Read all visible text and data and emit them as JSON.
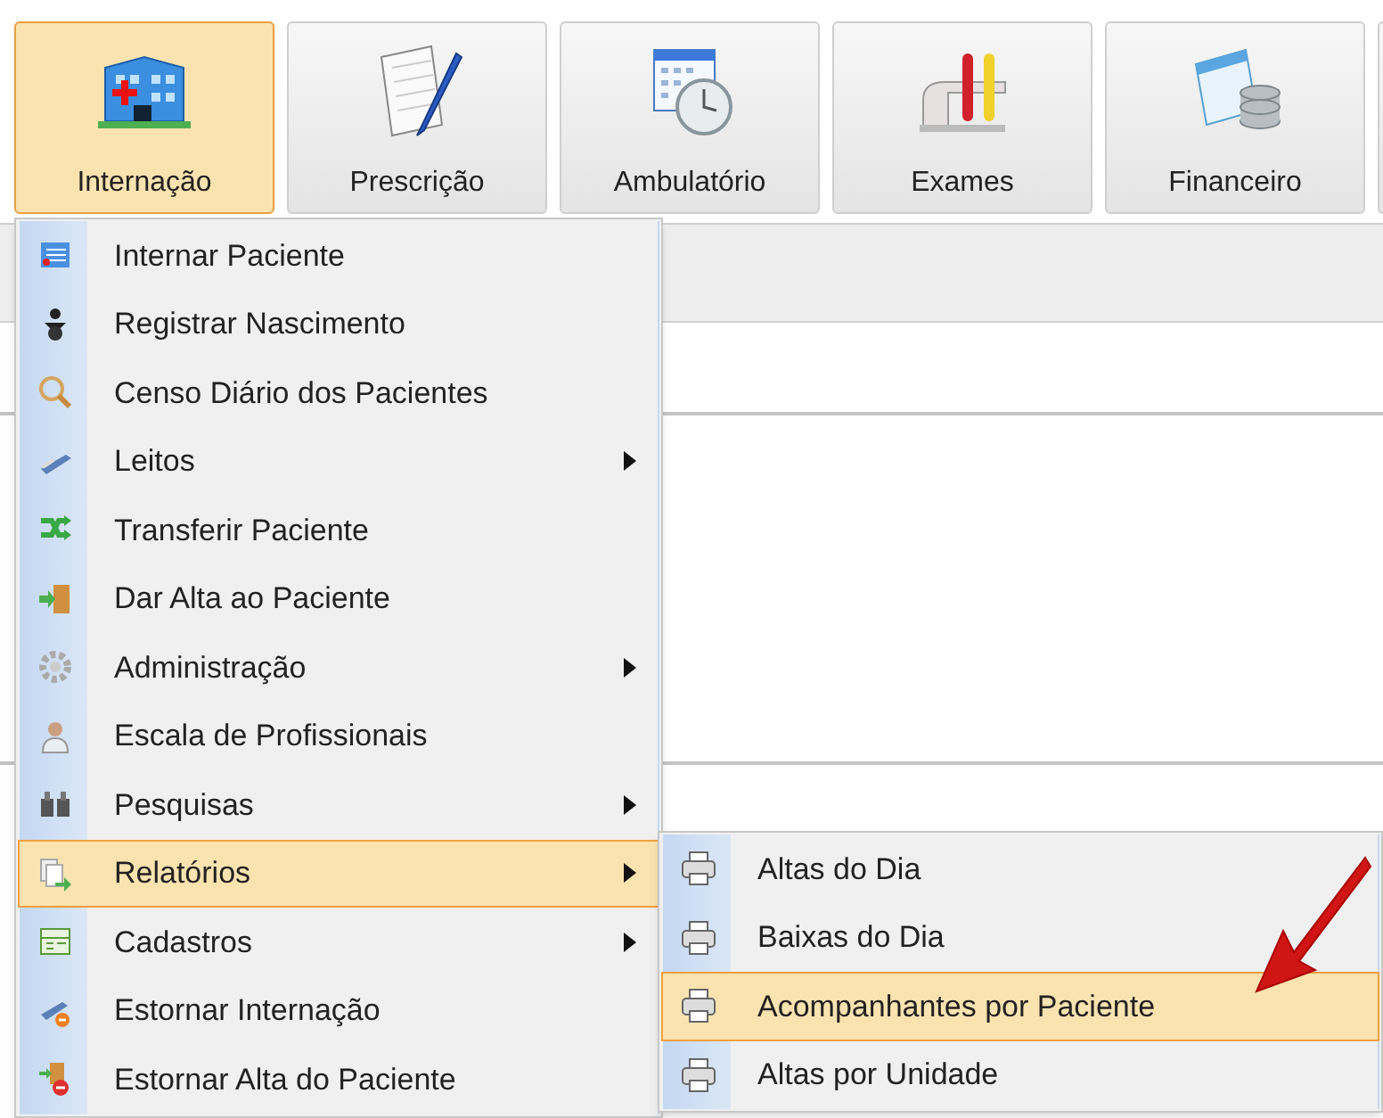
{
  "toolbar": [
    {
      "label": "Internação",
      "selected": true
    },
    {
      "label": "Prescrição",
      "selected": false
    },
    {
      "label": "Ambulatório",
      "selected": false
    },
    {
      "label": "Exames",
      "selected": false
    },
    {
      "label": "Financeiro",
      "selected": false
    }
  ],
  "menu": {
    "items": [
      {
        "label": "Internar Paciente",
        "has_submenu": false,
        "selected": false
      },
      {
        "label": "Registrar Nascimento",
        "has_submenu": false,
        "selected": false
      },
      {
        "label": "Censo Diário dos Pacientes",
        "has_submenu": false,
        "selected": false
      },
      {
        "label": "Leitos",
        "has_submenu": true,
        "selected": false
      },
      {
        "label": "Transferir Paciente",
        "has_submenu": false,
        "selected": false
      },
      {
        "label": "Dar Alta ao Paciente",
        "has_submenu": false,
        "selected": false
      },
      {
        "label": "Administração",
        "has_submenu": true,
        "selected": false
      },
      {
        "label": "Escala de Profissionais",
        "has_submenu": false,
        "selected": false
      },
      {
        "label": "Pesquisas",
        "has_submenu": true,
        "selected": false
      },
      {
        "label": "Relatórios",
        "has_submenu": true,
        "selected": true
      },
      {
        "label": "Cadastros",
        "has_submenu": true,
        "selected": false
      },
      {
        "label": "Estornar Internação",
        "has_submenu": false,
        "selected": false
      },
      {
        "label": "Estornar Alta do Paciente",
        "has_submenu": false,
        "selected": false
      }
    ]
  },
  "submenu": {
    "items": [
      {
        "label": "Altas do Dia",
        "selected": false
      },
      {
        "label": "Baixas do Dia",
        "selected": false
      },
      {
        "label": "Acompanhantes por Paciente",
        "selected": true
      },
      {
        "label": "Altas por Unidade",
        "selected": false
      }
    ]
  }
}
